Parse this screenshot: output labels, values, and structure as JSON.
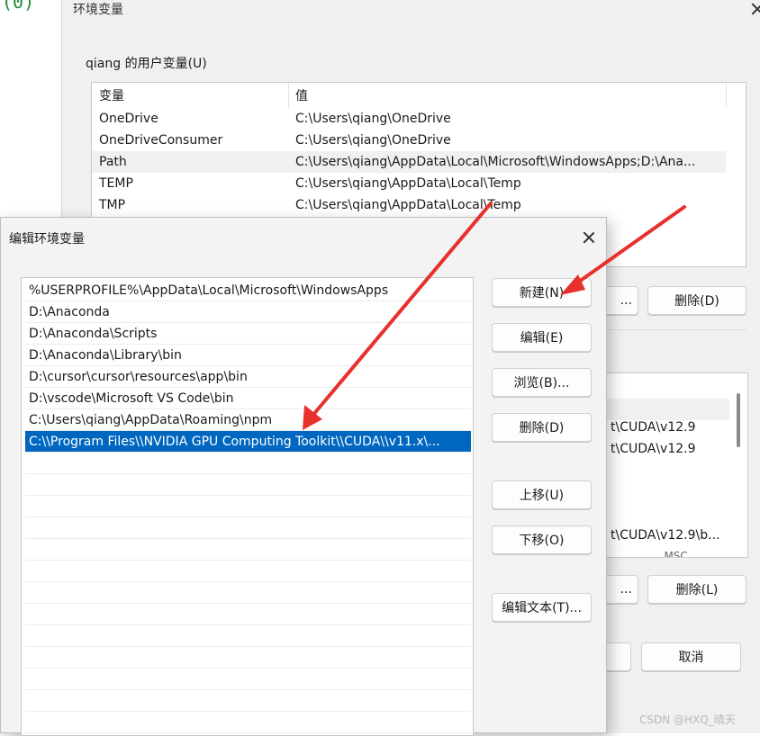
{
  "bg_window": {
    "title": "环境变量",
    "user_section_title": "qiang 的用户变量(U)",
    "columns": [
      "变量",
      "值"
    ],
    "user_vars": [
      {
        "name": "OneDrive",
        "value": "C:\\Users\\qiang\\OneDrive"
      },
      {
        "name": "OneDriveConsumer",
        "value": "C:\\Users\\qiang\\OneDrive"
      },
      {
        "name": "Path",
        "value": "C:\\Users\\qiang\\AppData\\Local\\Microsoft\\WindowsApps;D:\\Ana..."
      },
      {
        "name": "TEMP",
        "value": "C:\\Users\\qiang\\AppData\\Local\\Temp"
      },
      {
        "name": "TMP",
        "value": "C:\\Users\\qiang\\AppData\\Local\\Temp"
      }
    ],
    "user_new_partial": "...",
    "user_delete_label": "删除(D)",
    "system_vars_partial": [
      "t\\CUDA\\v12.9",
      "t\\CUDA\\v12.9",
      "t\\CUDA\\v12.9\\b...",
      "...MSC"
    ],
    "system_new_partial": "...",
    "system_delete_label": "删除(L)",
    "ok_partial": "",
    "cancel_label": "取消"
  },
  "edit_dialog": {
    "title": "编辑环境变量",
    "entries": [
      "%USERPROFILE%\\AppData\\Local\\Microsoft\\WindowsApps",
      "D:\\Anaconda",
      "D:\\Anaconda\\Scripts",
      "D:\\Anaconda\\Library\\bin",
      "D:\\cursor\\cursor\\resources\\app\\bin",
      "D:\\vscode\\Microsoft VS Code\\bin",
      "C:\\Users\\qiang\\AppData\\Roaming\\npm",
      "C:\\\\Program Files\\\\NVIDIA GPU Computing Toolkit\\\\CUDA\\\\v11.x\\..."
    ],
    "selected_index": 7,
    "buttons": {
      "new": "新建(N)",
      "edit": "编辑(E)",
      "browse": "浏览(B)...",
      "delete": "删除(D)",
      "move_up": "上移(U)",
      "move_down": "下移(O)",
      "edit_text": "编辑文本(T)..."
    }
  },
  "corner_text": "(0)",
  "watermark": "CSDN @HXQ_晴天",
  "colors": {
    "selection": "#0067c0",
    "arrow": "#e8312c",
    "dialog_bg": "#f3f3f3"
  }
}
